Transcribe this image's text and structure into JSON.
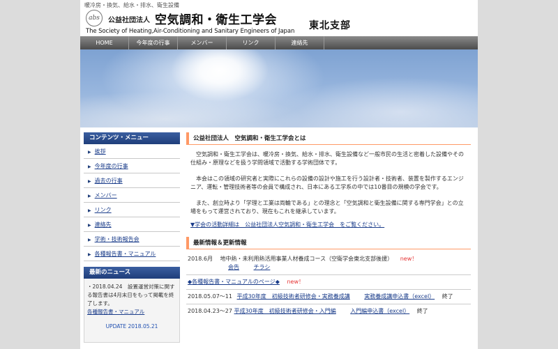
{
  "header": {
    "tagline": "暖冷房・換気、給水・排水、衛生設備",
    "logo_text": "abs",
    "org_prefix": "公益社団法人",
    "org_name": "空気調和・衛生工学会",
    "org_english": "The Society of Heating,Air-Conditioning and Sanitary Engineers of Japan",
    "branch": "東北支部"
  },
  "nav": [
    "HOME",
    "今年度の行事",
    "メンバー",
    "リンク",
    "連絡先"
  ],
  "sidebar": {
    "menu_title": "コンテンツ・メニュー",
    "menu": [
      "挨拶",
      "今年度の行事",
      "過去の行事",
      "メンバー",
      "リンク",
      "連絡先",
      "学術・技術報告会",
      "各種報告書・マニュアル"
    ],
    "news_title": "最新のニュース",
    "news_text": "・2018.04.24　設置運営対策に関する報告書は4月末日をもって掲載を終了します。",
    "news_link": "各種報告書・マニュアル",
    "update": "UPDATE 2018.05.21"
  },
  "about": {
    "title": "公益社団法人　空気調和・衛生工学会とは",
    "p1": "空気調和・衛生工学会は、暖冷房・換気、給水・排水、衛生設備など一般市民の生活と密着した設備やその仕組み・原理などを扱う学問領域で活動する学術団体です。",
    "p2": "本会はこの領域の研究者と実際にこれらの設備の設計や施工を行う設計者・技術者、装置を製作するエンジニア、運転・管理技術者等の会員で構成され、日本にある工学系の中では10番目の規模の学会です。",
    "p3": "また、創立時より「学理と工業は両輪である」との理念と「空気調和と衛生設備に関する専門学会」との立場をもって運営されており、現在もこれを継承しています。",
    "link": "▼学会の活動詳細は　公益社団法人空気調和・衛生工学会　をご覧ください。"
  },
  "updates": {
    "title": "最新情報＆更新情報",
    "row1_date": "2018.6月",
    "row1_text": "地中熱・未利用熱活用事業人材養成コース（空衛学会東北支部後援）",
    "row1_new": "new！",
    "row1_link_a": "会告",
    "row1_link_b": "チラシ",
    "row2_link": "◆各種報告書・マニュアルのページ◆",
    "row2_new": "new！",
    "row3_date": "2018.05.07～11",
    "row3_link_a": "平成30年度　初級技術者研修会・実務養成講",
    "row3_link_b": "実務養成講申込書（excel）",
    "row3_status": "終了",
    "row4_date": "2018.04.23～27",
    "row4_link_a": "平成30年度　初級技術者研修会・入門編",
    "row4_link_b": "入門編申込書（excel）",
    "row4_status": "終了"
  }
}
